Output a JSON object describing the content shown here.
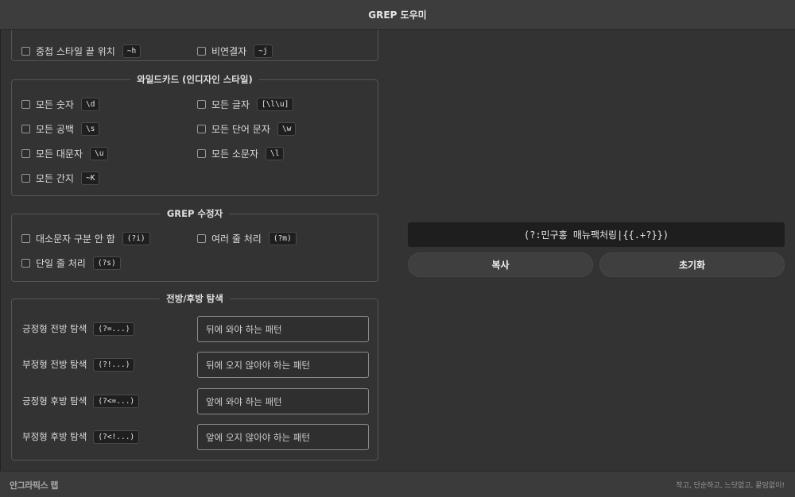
{
  "window": {
    "title": "GREP 도우미"
  },
  "group_top": {
    "options": [
      {
        "label": "중첩 스타일 끝 위치",
        "code": "~h"
      },
      {
        "label": "비연결자",
        "code": "~j"
      }
    ]
  },
  "group_wildcards": {
    "title": "와일드카드 (인디자인 스타일)",
    "options": [
      {
        "label": "모든 숫자",
        "code": "\\d"
      },
      {
        "label": "모든 글자",
        "code": "[\\l\\u]"
      },
      {
        "label": "모든 공백",
        "code": "\\s"
      },
      {
        "label": "모든 단어 문자",
        "code": "\\w"
      },
      {
        "label": "모든 대문자",
        "code": "\\u"
      },
      {
        "label": "모든 소문자",
        "code": "\\l"
      },
      {
        "label": "모든 간지",
        "code": "~K"
      }
    ]
  },
  "group_modifiers": {
    "title": "GREP 수정자",
    "options": [
      {
        "label": "대소문자 구분 안 함",
        "code": "(?i)"
      },
      {
        "label": "여러 줄 처리",
        "code": "(?m)"
      },
      {
        "label": "단일 줄 처리",
        "code": "(?s)"
      }
    ]
  },
  "group_lookaround": {
    "title": "전방/후방 탐색",
    "rows": [
      {
        "label": "긍정형 전방 탐색",
        "code": "(?=...)",
        "placeholder": "뒤에 와야 하는 패턴"
      },
      {
        "label": "부정형 전방 탐색",
        "code": "(?!...)",
        "placeholder": "뒤에 오지 않아야 하는 패턴"
      },
      {
        "label": "긍정형 후방 탐색",
        "code": "(?<=...)",
        "placeholder": "앞에 와야 하는 패턴"
      },
      {
        "label": "부정형 후방 탐색",
        "code": "(?<!...)",
        "placeholder": "앞에 오지 않아야 하는 패턴"
      }
    ]
  },
  "output": {
    "expression": "(?:민구홍 매뉴팩처링|{{.+?}})",
    "copy_label": "복사",
    "reset_label": "초기화"
  },
  "footer": {
    "brand": "안그라픽스 랩",
    "slogan": "작고, 단순하고, 느닷없고, 끝임없이!"
  }
}
